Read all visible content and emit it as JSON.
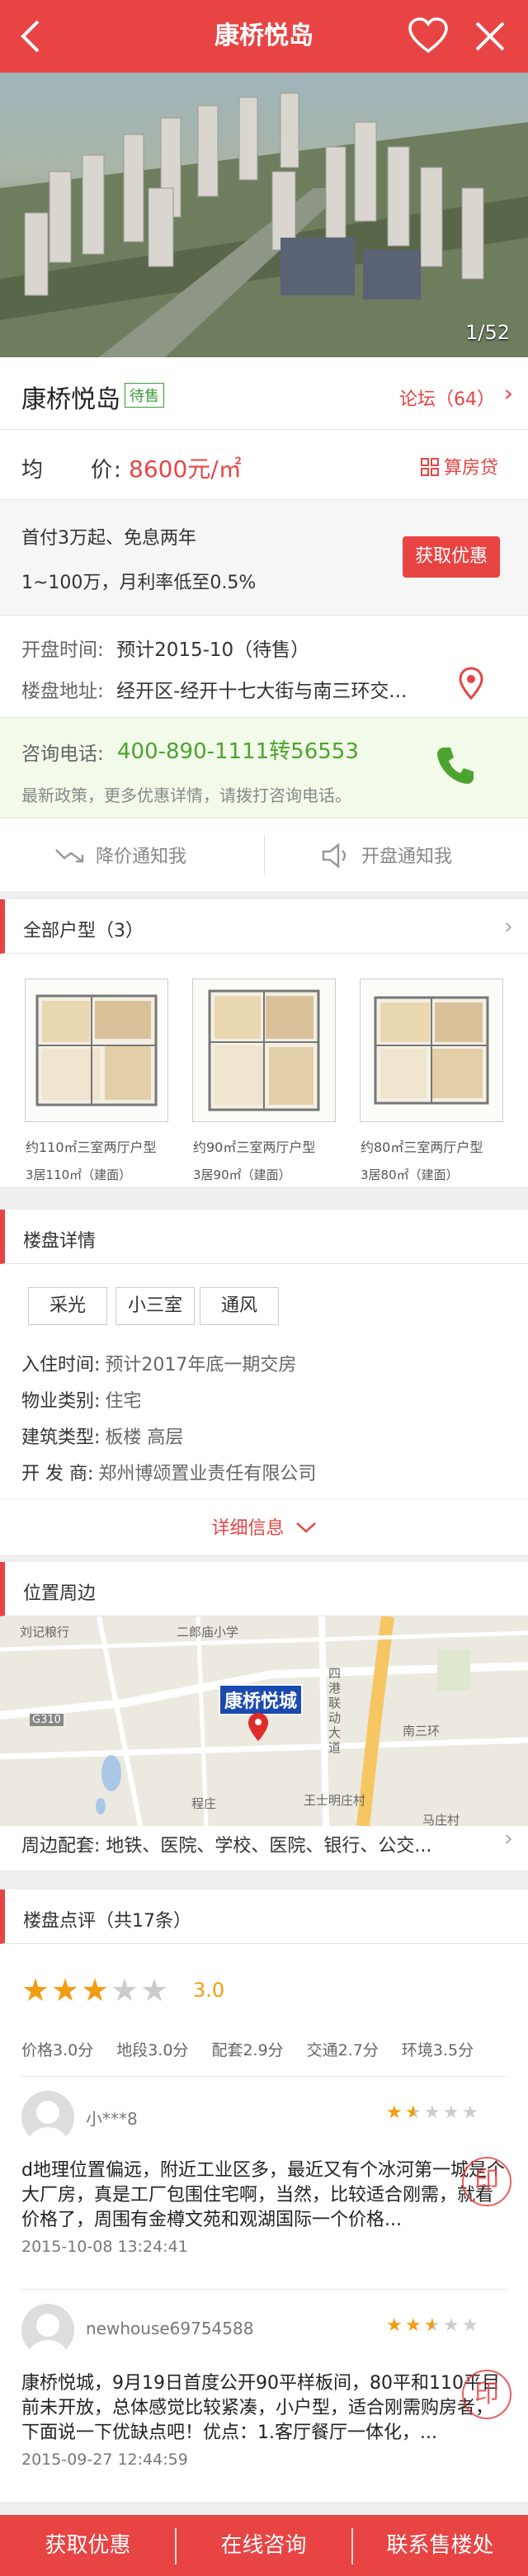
{
  "header": {
    "title": "康桥悦岛"
  },
  "hero": {
    "counter": "1/52"
  },
  "project": {
    "name": "康桥悦岛",
    "status": "待售",
    "forum": "论坛（64）"
  },
  "price": {
    "label": "均　　价:",
    "value": "8600元/㎡",
    "calc": "算房贷"
  },
  "promo": {
    "line1": "首付3万起、免息两年",
    "line2": "1~100万，月利率低至0.5%",
    "button": "获取优惠"
  },
  "info": {
    "open_label": "开盘时间:",
    "open_value": "预计2015-10（待售）",
    "addr_label": "楼盘地址:",
    "addr_value": "经开区-经开十七大街与南三环交..."
  },
  "phone": {
    "label": "咨询电话:",
    "number": "400-890-1111转56553",
    "tip": "最新政策，更多优惠详情，请拨打咨询电话。"
  },
  "notify": {
    "price": "降价通知我",
    "open": "开盘通知我"
  },
  "plans": {
    "title": "全部户型（3）",
    "items": [
      {
        "caption": "约110㎡三室两厅户型",
        "sub": "3居110㎡（建面）"
      },
      {
        "caption": "约90㎡三室两厅户型",
        "sub": "3居90㎡（建面）"
      },
      {
        "caption": "约80㎡三室两厅户型",
        "sub": "3居80㎡（建面）"
      }
    ]
  },
  "detail": {
    "title": "楼盘详情",
    "tags": [
      "采光",
      "小三室",
      "通风"
    ],
    "rows": [
      {
        "k": "入住时间:",
        "v": "预计2017年底一期交房"
      },
      {
        "k": "物业类别:",
        "v": "住宅"
      },
      {
        "k": "建筑类型:",
        "v": "板楼  高层"
      },
      {
        "k": "开 发 商:",
        "v": "郑州博颂置业责任有限公司"
      }
    ],
    "more": "详细信息"
  },
  "location": {
    "title": "位置周边",
    "map_pin": "康桥悦城",
    "map_labels": [
      "刘记粮行",
      "二郎庙小学",
      "G310",
      "南三环",
      "四港联动大道",
      "程庄",
      "王士明庄村",
      "马庄村"
    ],
    "around": "周边配套: 地铁、医院、学校、医院、银行、公交..."
  },
  "review": {
    "title": "楼盘点评（共17条）",
    "score": "3.0",
    "score_stars": 3,
    "dims": [
      "价格3.0分",
      "地段3.0分",
      "配套2.9分",
      "交通2.7分",
      "环境3.5分"
    ],
    "items": [
      {
        "user": "小***8",
        "stars": 1.5,
        "text": "d地理位置偏远，附近工业区多，最近又有个冰河第一城是个大厂房，真是工厂包围住宅啊，当然，比较适合刚需，就看价格了，周围有金樽文苑和观湖国际一个价格...",
        "date": "2015-10-08 13:24:41"
      },
      {
        "user": "newhouse69754588",
        "stars": 2.5,
        "text": "康桥悦城，9月19日首度公开90平样板间，80平和110平目前未开放，总体感觉比较紧凑，小户型，适合刚需购房者，下面说一下优缺点吧！优点：1.客厅餐厅一体化，...",
        "date": "2015-09-27 12:44:59"
      }
    ]
  },
  "footer": {
    "b1": "获取优惠",
    "b2": "在线咨询",
    "b3": "联系售楼处"
  },
  "colors": {
    "accent": "#e84444",
    "green": "#4da32f",
    "star": "#f39c12"
  }
}
